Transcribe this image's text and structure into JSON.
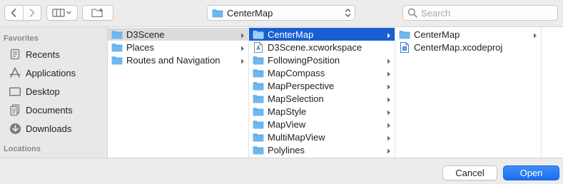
{
  "toolbar": {
    "back_icon": "chevron-left-icon",
    "forward_icon": "chevron-right-icon",
    "view_icon": "column-view-icon",
    "new_folder_icon": "new-folder-icon",
    "location_label": "CenterMap",
    "search_placeholder": "Search"
  },
  "sidebar": {
    "favorites_heading": "Favorites",
    "locations_heading": "Locations",
    "items": [
      {
        "label": "Recents",
        "icon": "recents-icon"
      },
      {
        "label": "Applications",
        "icon": "applications-icon"
      },
      {
        "label": "Desktop",
        "icon": "desktop-icon"
      },
      {
        "label": "Documents",
        "icon": "documents-icon"
      },
      {
        "label": "Downloads",
        "icon": "downloads-icon"
      }
    ]
  },
  "columns": {
    "col1": [
      {
        "label": "D3Scene",
        "type": "folder",
        "selected": "gray",
        "chevron": true
      },
      {
        "label": "Places",
        "type": "folder",
        "selected": "none",
        "chevron": true
      },
      {
        "label": "Routes and Navigation",
        "type": "folder",
        "selected": "none",
        "chevron": true
      }
    ],
    "col2": [
      {
        "label": "CenterMap",
        "type": "folder",
        "selected": "blue",
        "chevron": true
      },
      {
        "label": "D3Scene.xcworkspace",
        "type": "workspace",
        "selected": "none",
        "chevron": false
      },
      {
        "label": "FollowingPosition",
        "type": "folder",
        "selected": "none",
        "chevron": true
      },
      {
        "label": "MapCompass",
        "type": "folder",
        "selected": "none",
        "chevron": true
      },
      {
        "label": "MapPerspective",
        "type": "folder",
        "selected": "none",
        "chevron": true
      },
      {
        "label": "MapSelection",
        "type": "folder",
        "selected": "none",
        "chevron": true
      },
      {
        "label": "MapStyle",
        "type": "folder",
        "selected": "none",
        "chevron": true
      },
      {
        "label": "MapView",
        "type": "folder",
        "selected": "none",
        "chevron": true
      },
      {
        "label": "MultiMapView",
        "type": "folder",
        "selected": "none",
        "chevron": true
      },
      {
        "label": "Polylines",
        "type": "folder",
        "selected": "none",
        "chevron": true
      }
    ],
    "col3": [
      {
        "label": "CenterMap",
        "type": "folder",
        "selected": "none",
        "chevron": true
      },
      {
        "label": "CenterMap.xcodeproj",
        "type": "xcodeproj",
        "selected": "none",
        "chevron": false
      }
    ]
  },
  "footer": {
    "cancel_label": "Cancel",
    "open_label": "Open"
  },
  "colors": {
    "accent": "#1a5fd1",
    "folder": "#6fb8ef",
    "sidebar_icon": "#7a7a7a"
  }
}
